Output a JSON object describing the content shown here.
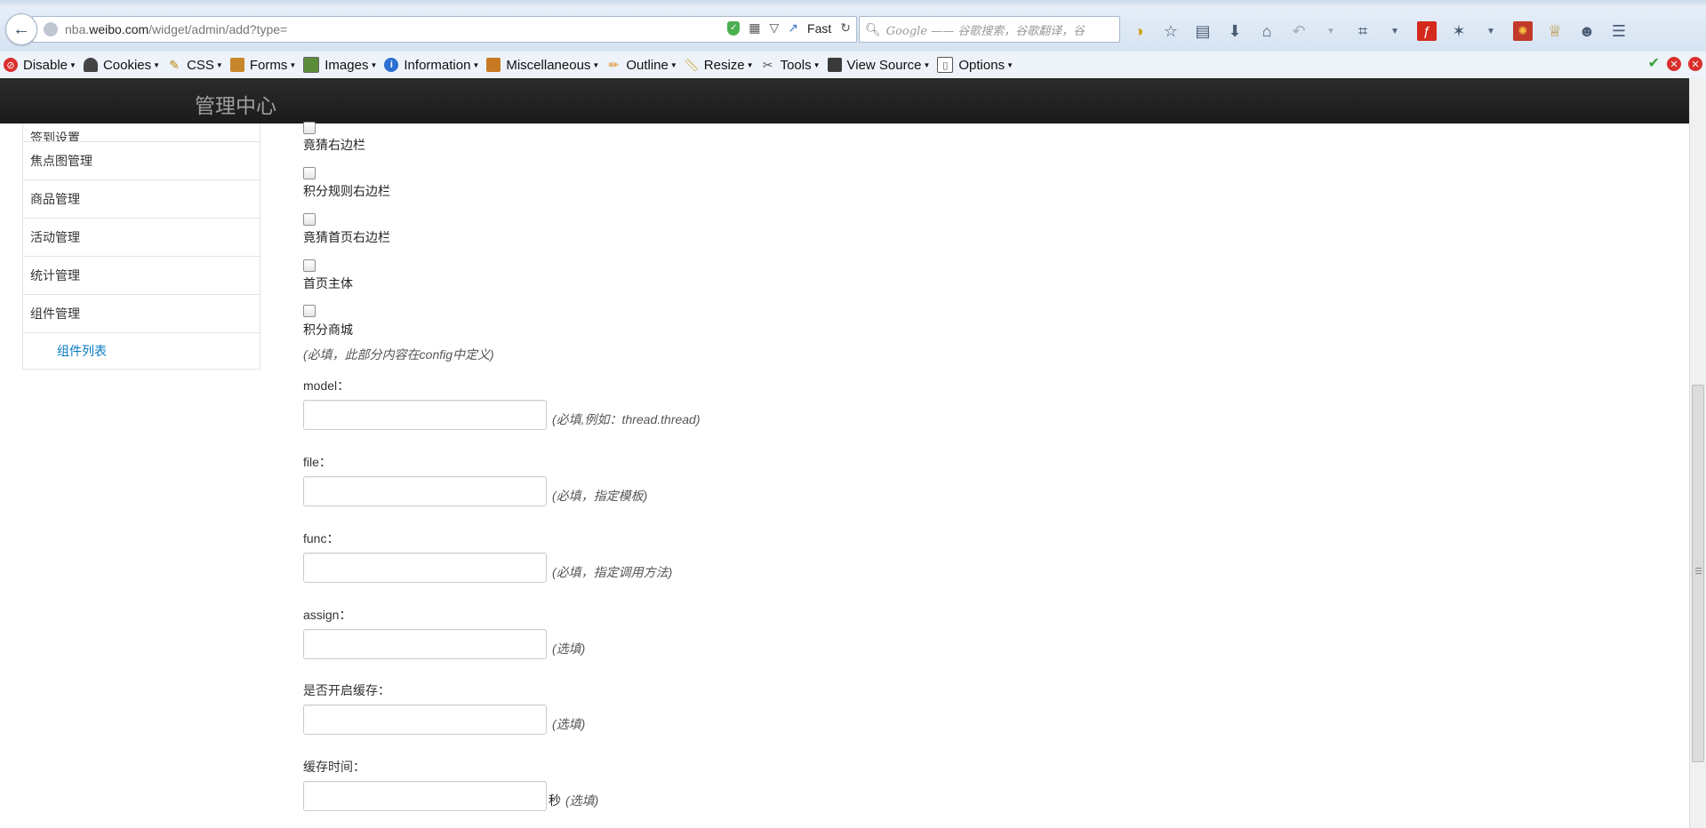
{
  "browser": {
    "url_prefix": "nba.",
    "url_domain": "weibo.com",
    "url_path": "/widget/admin/add?type=",
    "speed_label": "Fast",
    "search_placeholder": "Google —— 谷歌搜索，谷歌翻译，谷",
    "accent_color": "#d6e3f2"
  },
  "devbar": {
    "items": [
      {
        "label": "Disable",
        "icon": "disable-icon"
      },
      {
        "label": "Cookies",
        "icon": "cookies-icon"
      },
      {
        "label": "CSS",
        "icon": "css-icon"
      },
      {
        "label": "Forms",
        "icon": "forms-icon"
      },
      {
        "label": "Images",
        "icon": "images-icon"
      },
      {
        "label": "Information",
        "icon": "information-icon"
      },
      {
        "label": "Miscellaneous",
        "icon": "miscellaneous-icon"
      },
      {
        "label": "Outline",
        "icon": "outline-icon"
      },
      {
        "label": "Resize",
        "icon": "resize-icon"
      },
      {
        "label": "Tools",
        "icon": "tools-icon"
      },
      {
        "label": "View Source",
        "icon": "view-source-icon"
      },
      {
        "label": "Options",
        "icon": "options-icon"
      }
    ]
  },
  "header": {
    "title": "管理中心",
    "bg_color": "#1f1f1f"
  },
  "sidebar": {
    "items": [
      {
        "label": "签到设置"
      },
      {
        "label": "焦点图管理"
      },
      {
        "label": "商品管理"
      },
      {
        "label": "活动管理"
      },
      {
        "label": "统计管理"
      },
      {
        "label": "组件管理"
      }
    ],
    "sub_item": "组件列表",
    "link_color": "#0a7ac2"
  },
  "form": {
    "checkboxes": [
      {
        "label": "竟猜右边栏",
        "checked": false
      },
      {
        "label": "积分规则右边栏",
        "checked": false
      },
      {
        "label": "竟猜首页右边栏",
        "checked": false
      },
      {
        "label": "首页主体",
        "checked": false
      },
      {
        "label": "积分商城",
        "checked": false
      }
    ],
    "position_note": "(必填，此部分内容在config中定义)",
    "fields": [
      {
        "label": "model：",
        "value": "",
        "hint": "(必填,例如：thread.thread)"
      },
      {
        "label": "file：",
        "value": "",
        "hint": "(必填，指定模板)"
      },
      {
        "label": "func：",
        "value": "",
        "hint": "(必填，指定调用方法)"
      },
      {
        "label": "assign：",
        "value": "",
        "hint": "(选填)"
      },
      {
        "label": "是否开启缓存：",
        "value": "",
        "hint": "(选填)"
      },
      {
        "label": "缓存时间：",
        "value": "",
        "unit": "秒",
        "hint": "(选填)"
      }
    ]
  }
}
